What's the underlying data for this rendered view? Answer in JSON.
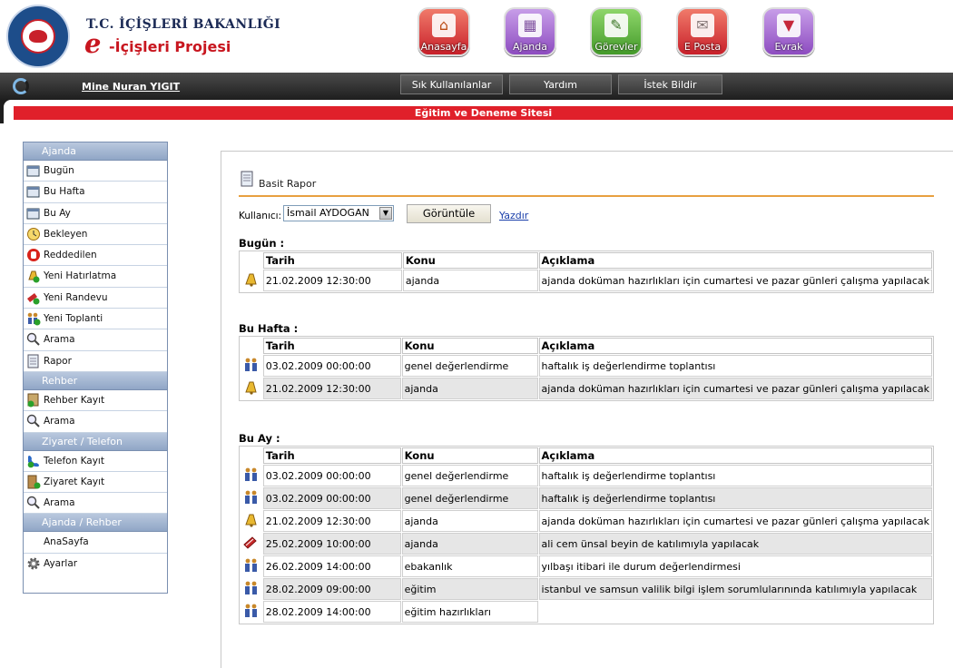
{
  "header": {
    "ministry": "T.C. İÇİŞLERİ BAKANLIĞI",
    "project_e": "e",
    "project_name": "-İçişleri Projesi",
    "top_icons": [
      {
        "label": "Anasayfa",
        "icon": "home-icon",
        "color": "#e04040"
      },
      {
        "label": "Ajanda",
        "icon": "calendar-icon",
        "color": "#9a5bc9"
      },
      {
        "label": "Görevler",
        "icon": "tasks-icon",
        "color": "#58a83a"
      },
      {
        "label": "E Posta",
        "icon": "mail-icon",
        "color": "#e04040"
      },
      {
        "label": "Evrak",
        "icon": "document-icon",
        "color": "#9a5bc9"
      }
    ]
  },
  "navbar": {
    "user_name": "Mine Nuran YIGIT",
    "buttons": [
      "Sık Kullanılanlar",
      "Yardım",
      "İstek Bildir"
    ]
  },
  "banner": "Eğitim ve Deneme Sitesi",
  "sidebar": {
    "sections": [
      {
        "title": "Ajanda",
        "items": [
          {
            "label": "Bugün",
            "icon": "calendar-today-icon"
          },
          {
            "label": "Bu Hafta",
            "icon": "calendar-week-icon"
          },
          {
            "label": "Bu Ay",
            "icon": "calendar-month-icon"
          },
          {
            "label": "Bekleyen",
            "icon": "clock-icon"
          },
          {
            "label": "Reddedilen",
            "icon": "reject-icon"
          },
          {
            "label": "Yeni Hatırlatma",
            "icon": "bell-add-icon"
          },
          {
            "label": "Yeni Randevu",
            "icon": "appointment-add-icon"
          },
          {
            "label": "Yeni Toplanti",
            "icon": "meeting-add-icon"
          },
          {
            "label": "Arama",
            "icon": "search-icon"
          },
          {
            "label": "Rapor",
            "icon": "report-icon"
          }
        ]
      },
      {
        "title": "Rehber",
        "items": [
          {
            "label": "Rehber Kayıt",
            "icon": "contact-add-icon"
          },
          {
            "label": "Arama",
            "icon": "search-icon"
          }
        ]
      },
      {
        "title": "Ziyaret / Telefon",
        "items": [
          {
            "label": "Telefon Kayıt",
            "icon": "phone-icon"
          },
          {
            "label": "Ziyaret Kayıt",
            "icon": "visit-add-icon"
          },
          {
            "label": "Arama",
            "icon": "search-icon"
          }
        ]
      },
      {
        "title": "Ajanda / Rehber",
        "items": [
          {
            "label": "AnaSayfa",
            "icon": ""
          },
          {
            "label": "Ayarlar",
            "icon": "gear-icon"
          }
        ]
      }
    ]
  },
  "report": {
    "title": "Basit Rapor",
    "user_label": "Kullanıcı:",
    "selected_user": "İsmail AYDOGAN",
    "view_button": "Görüntüle",
    "print_link": "Yazdır",
    "columns": [
      "Tarih",
      "Konu",
      "Açıklama"
    ],
    "sections": [
      {
        "title": "Bugün :",
        "rows": [
          {
            "icon": "bell-icon",
            "date": "21.02.2009 12:30:00",
            "subject": "ajanda",
            "description": "ajanda doküman hazırlıkları için cumartesi ve pazar günleri çalışma yapılacak"
          }
        ]
      },
      {
        "title": "Bu Hafta :",
        "rows": [
          {
            "icon": "meeting-icon",
            "date": "03.02.2009 00:00:00",
            "subject": "genel değerlendirme",
            "description": "haftalık iş değerlendirme toplantısı"
          },
          {
            "icon": "bell-icon",
            "date": "21.02.2009 12:30:00",
            "subject": "ajanda",
            "description": "ajanda doküman hazırlıkları için cumartesi ve pazar günleri çalışma yapılacak"
          }
        ]
      },
      {
        "title": "Bu Ay :",
        "rows": [
          {
            "icon": "meeting-icon",
            "date": "03.02.2009 00:00:00",
            "subject": "genel değerlendirme",
            "description": "haftalık iş değerlendirme toplantısı"
          },
          {
            "icon": "meeting-icon",
            "date": "03.02.2009 00:00:00",
            "subject": "genel değerlendirme",
            "description": "haftalık iş değerlendirme toplantısı"
          },
          {
            "icon": "bell-icon",
            "date": "21.02.2009 12:30:00",
            "subject": "ajanda",
            "description": "ajanda doküman hazırlıkları için cumartesi ve pazar günleri çalışma yapılacak"
          },
          {
            "icon": "appointment-icon",
            "date": "25.02.2009 10:00:00",
            "subject": "ajanda",
            "description": "ali cem ünsal beyin de katılımıyla yapılacak"
          },
          {
            "icon": "meeting-icon",
            "date": "26.02.2009 14:00:00",
            "subject": "ebakanlık",
            "description": "yılbaşı itibari ile durum değerlendirmesi"
          },
          {
            "icon": "meeting-icon",
            "date": "28.02.2009 09:00:00",
            "subject": "eğitim",
            "description": "istanbul ve samsun valilik bilgi işlem sorumlularınında katılımıyla yapılacak"
          },
          {
            "icon": "meeting-icon",
            "date": "28.02.2009 14:00:00",
            "subject": "eğitim hazırlıkları",
            "description": ""
          }
        ]
      }
    ]
  }
}
